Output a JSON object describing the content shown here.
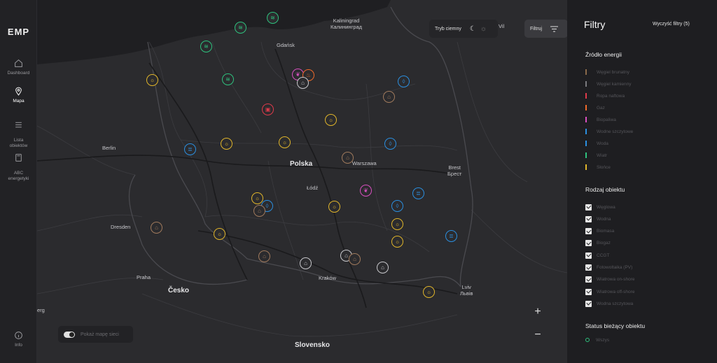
{
  "app": {
    "logo": "EMP"
  },
  "nav": [
    {
      "id": "dashboard",
      "label": "Dashboard",
      "icon": "home-icon",
      "active": false
    },
    {
      "id": "mapa",
      "label": "Mapa",
      "icon": "map-pin-icon",
      "active": true
    },
    {
      "id": "lista",
      "label": "Lista\nobiektów",
      "icon": "list-icon",
      "active": false
    },
    {
      "id": "abc",
      "label": "ABC\nenergetyki",
      "icon": "book-icon",
      "active": false
    },
    {
      "id": "info",
      "label": "Info",
      "icon": "info-icon",
      "active": false
    }
  ],
  "map": {
    "dark_mode_label": "Tryb ciemny",
    "filter_button_label": "Filtruj",
    "zoom_in": "+",
    "zoom_out": "−",
    "grid_toggle_label": "Pokaż mapę sieci",
    "cities": [
      {
        "id": "kaliningrad",
        "name": "Kaliningrad\nКалининград"
      },
      {
        "id": "gdansk",
        "name": "Gdańsk"
      },
      {
        "id": "berlin",
        "name": "Berlin"
      },
      {
        "id": "warszawa",
        "name": "Warszawa"
      },
      {
        "id": "lodz",
        "name": "Łódź"
      },
      {
        "id": "brest",
        "name": "Brest\nБрест"
      },
      {
        "id": "dresden",
        "name": "Dresden"
      },
      {
        "id": "praha",
        "name": "Praha"
      },
      {
        "id": "krakow",
        "name": "Kraków"
      },
      {
        "id": "lviv",
        "name": "Lviv\nЛьвів"
      },
      {
        "id": "erg",
        "name": "erg"
      },
      {
        "id": "vil",
        "name": "Vil"
      }
    ],
    "countries": [
      {
        "id": "polska",
        "name": "Polska"
      },
      {
        "id": "cesko",
        "name": "Česko"
      },
      {
        "id": "slovensko",
        "name": "Slovensko"
      }
    ]
  },
  "filters": {
    "title": "Filtry",
    "clear_label": "Wyczyść filtry (5)",
    "energy_source": {
      "title": "Źródło energii",
      "items": [
        {
          "label": "Węgiel brunatny",
          "color": "#8a6a4a"
        },
        {
          "label": "Węgiel kamienny",
          "color": "#7a7a7e"
        },
        {
          "label": "Ropa naftowa",
          "color": "#e03a4a"
        },
        {
          "label": "Gaz",
          "color": "#f06a2a"
        },
        {
          "label": "Biopaliwa",
          "color": "#d94fc0"
        },
        {
          "label": "Wodne szczytowe",
          "color": "#2b8fe0"
        },
        {
          "label": "Woda",
          "color": "#2b8fe0"
        },
        {
          "label": "Wiatr",
          "color": "#2ec27e"
        },
        {
          "label": "Słońce",
          "color": "#e0b52a"
        }
      ]
    },
    "object_type": {
      "title": "Rodzaj obiektu",
      "items": [
        "Węglowa",
        "Wodna",
        "Biomasa",
        "Biogaz",
        "CCGT",
        "Fotowoltaika (PV)",
        "Wiatrowa on-shore",
        "Wiatrowa off-shore",
        "Wodna szczytowa"
      ]
    },
    "status": {
      "title": "Status bieżący obiektu",
      "items": [
        {
          "label": "Wszys",
          "color": "#2ec27e"
        }
      ]
    }
  }
}
